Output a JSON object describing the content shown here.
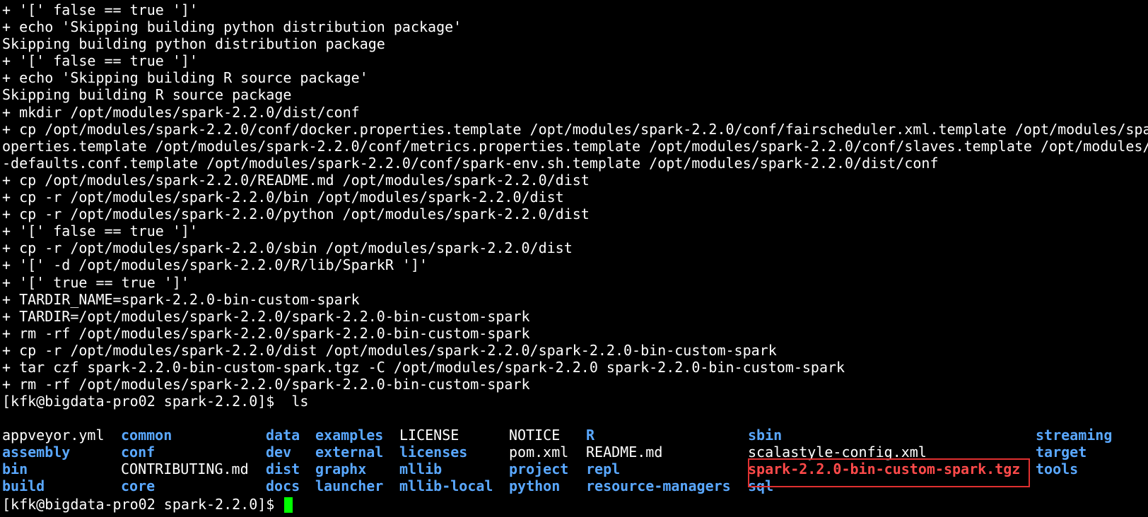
{
  "terminal": {
    "log_lines": [
      "+ '[' false == true ']'",
      "+ echo 'Skipping building python distribution package'",
      "Skipping building python distribution package",
      "+ '[' false == true ']'",
      "+ echo 'Skipping building R source package'",
      "Skipping building R source package",
      "+ mkdir /opt/modules/spark-2.2.0/dist/conf",
      "+ cp /opt/modules/spark-2.2.0/conf/docker.properties.template /opt/modules/spark-2.2.0/conf/fairscheduler.xml.template /opt/modules/spa",
      "operties.template /opt/modules/spark-2.2.0/conf/metrics.properties.template /opt/modules/spark-2.2.0/conf/slaves.template /opt/modules/",
      "-defaults.conf.template /opt/modules/spark-2.2.0/conf/spark-env.sh.template /opt/modules/spark-2.2.0/dist/conf",
      "+ cp /opt/modules/spark-2.2.0/README.md /opt/modules/spark-2.2.0/dist",
      "+ cp -r /opt/modules/spark-2.2.0/bin /opt/modules/spark-2.2.0/dist",
      "+ cp -r /opt/modules/spark-2.2.0/python /opt/modules/spark-2.2.0/dist",
      "+ '[' false == true ']'",
      "+ cp -r /opt/modules/spark-2.2.0/sbin /opt/modules/spark-2.2.0/dist",
      "+ '[' -d /opt/modules/spark-2.2.0/R/lib/SparkR ']'",
      "+ '[' true == true ']'",
      "+ TARDIR_NAME=spark-2.2.0-bin-custom-spark",
      "+ TARDIR=/opt/modules/spark-2.2.0/spark-2.2.0-bin-custom-spark",
      "+ rm -rf /opt/modules/spark-2.2.0/spark-2.2.0-bin-custom-spark",
      "+ cp -r /opt/modules/spark-2.2.0/dist /opt/modules/spark-2.2.0/spark-2.2.0-bin-custom-spark",
      "+ tar czf spark-2.2.0-bin-custom-spark.tgz -C /opt/modules/spark-2.2.0 spark-2.2.0-bin-custom-spark",
      "+ rm -rf /opt/modules/spark-2.2.0/spark-2.2.0-bin-custom-spark",
      "[kfk@bigdata-pro02 spark-2.2.0]$  ls"
    ],
    "ls_columns": [
      [
        {
          "name": "appveyor.yml",
          "type": "file"
        },
        {
          "name": "assembly",
          "type": "dir"
        },
        {
          "name": "bin",
          "type": "dir"
        },
        {
          "name": "build",
          "type": "dir"
        }
      ],
      [
        {
          "name": "common",
          "type": "dir"
        },
        {
          "name": "conf",
          "type": "dir"
        },
        {
          "name": "CONTRIBUTING.md",
          "type": "file"
        },
        {
          "name": "core",
          "type": "dir"
        }
      ],
      [
        {
          "name": "data",
          "type": "dir"
        },
        {
          "name": "dev",
          "type": "dir"
        },
        {
          "name": "dist",
          "type": "dir"
        },
        {
          "name": "docs",
          "type": "dir"
        }
      ],
      [
        {
          "name": "examples",
          "type": "dir"
        },
        {
          "name": "external",
          "type": "dir"
        },
        {
          "name": "graphx",
          "type": "dir"
        },
        {
          "name": "launcher",
          "type": "dir"
        }
      ],
      [
        {
          "name": "LICENSE",
          "type": "file"
        },
        {
          "name": "licenses",
          "type": "dir"
        },
        {
          "name": "mllib",
          "type": "dir"
        },
        {
          "name": "mllib-local",
          "type": "dir"
        }
      ],
      [
        {
          "name": "NOTICE",
          "type": "file"
        },
        {
          "name": "pom.xml",
          "type": "file"
        },
        {
          "name": "project",
          "type": "dir"
        },
        {
          "name": "python",
          "type": "dir"
        }
      ],
      [
        {
          "name": "R",
          "type": "dir"
        },
        {
          "name": "README.md",
          "type": "file"
        },
        {
          "name": "repl",
          "type": "dir"
        },
        {
          "name": "resource-managers",
          "type": "dir"
        }
      ],
      [
        {
          "name": "sbin",
          "type": "dir"
        },
        {
          "name": "scalastyle-config.xml",
          "type": "file"
        },
        {
          "name": "spark-2.2.0-bin-custom-spark.tgz",
          "type": "archive"
        },
        {
          "name": "sql",
          "type": "dir"
        }
      ],
      [
        {
          "name": "streaming",
          "type": "dir"
        },
        {
          "name": "target",
          "type": "dir"
        },
        {
          "name": "tools",
          "type": "dir"
        },
        {
          "name": "",
          "type": "file"
        }
      ]
    ],
    "prompt": "[kfk@bigdata-pro02 spark-2.2.0]$ ",
    "colors": {
      "background": "#000000",
      "foreground": "#ffffff",
      "directory": "#5aa8ff",
      "archive": "#ff4a4a",
      "cursor": "#00ff00",
      "highlight_box": "#e03030"
    }
  }
}
